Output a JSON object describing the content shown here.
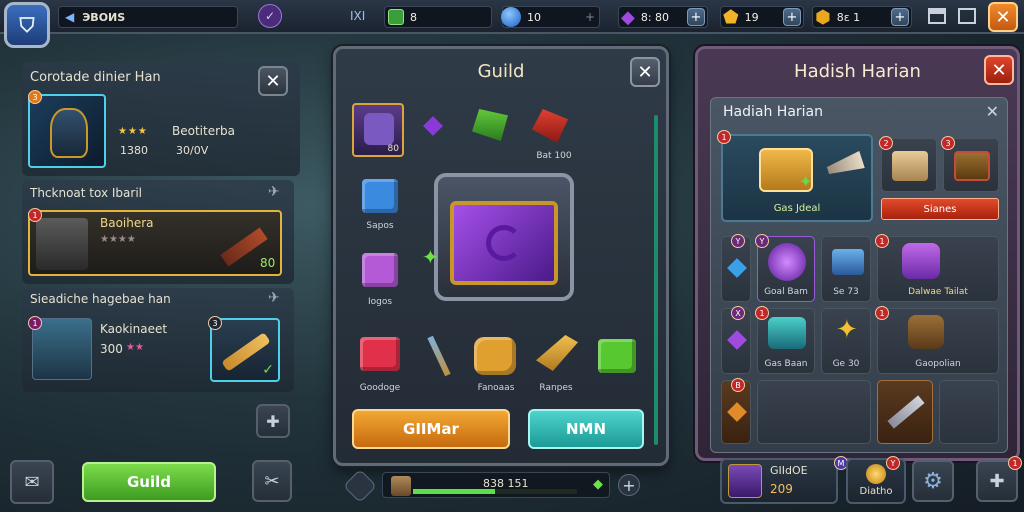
{
  "topbar": {
    "player_name": "ЭBOИS",
    "stat_label": "IXI",
    "res_green": "8",
    "res_blue": "10",
    "res_purple": "8: 80",
    "res_gold": "19",
    "res_gold2": "8ε 1"
  },
  "left": {
    "hero": {
      "title": "Corotade dinier Han",
      "level": "3",
      "name": "Beotiterba",
      "stat1": "1380",
      "stat2": "30/0V"
    },
    "section1": {
      "title": "Thcknoat tox Ibaril",
      "badge": "1",
      "name": "Baoihera",
      "value": "80"
    },
    "section2": {
      "title": "Sieadiche hagebae han",
      "badge": "1",
      "name": "Kaokinaeet",
      "value": "300",
      "slot_badge": "3"
    },
    "guild_button": "Guild"
  },
  "guild": {
    "title": "Guild",
    "portrait_count": "80",
    "items": [
      {
        "label": "Bat 100"
      },
      {
        "label": "Sapos"
      },
      {
        "label": "Iogos"
      },
      {
        "label": "Goodoge"
      },
      {
        "label": "Fanoaas"
      },
      {
        "label": "Ranpes"
      }
    ],
    "btn_primary": "GIIMar",
    "btn_secondary": "NMN"
  },
  "hadiah": {
    "title": "Hadish Harian",
    "subtitle": "Hadiah Harian",
    "featured_label": "Gas Jdeal",
    "claim_label": "Sianes",
    "badges": [
      "1",
      "2",
      "3"
    ],
    "slots": [
      {
        "label": "Goal Bam",
        "badge": "Y"
      },
      {
        "label": "Se 73"
      },
      {
        "label": "Dalwae Tailat",
        "badge": "1"
      },
      {
        "label": "Gas Baan",
        "badge": "1"
      },
      {
        "label": "Ge 30"
      },
      {
        "label": "Gaopolian",
        "badge": "1"
      }
    ],
    "col_badges": [
      "Y",
      "X",
      "B"
    ]
  },
  "bottom": {
    "progress_text": "838 151",
    "progress_fill": 0.5,
    "profile_name": "GIIdOE",
    "profile_value": "209",
    "profile_badge": "M",
    "extra_label": "Diatho",
    "extra_badge": "Y",
    "corner_badge": "1"
  },
  "colors": {
    "accent_orange": "#e7891c",
    "accent_teal": "#2bb5b0",
    "accent_green": "#57c23a",
    "close_red": "#d0391f",
    "purple": "#8a3ad8"
  }
}
